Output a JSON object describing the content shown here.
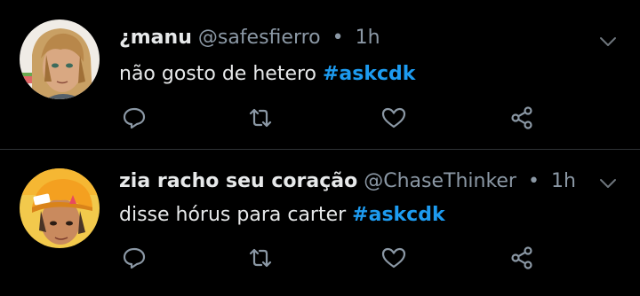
{
  "tweets": [
    {
      "display_name": "¿manu",
      "handle": "@safesfierro",
      "separator": "•",
      "time": "1h",
      "text": "não gosto de hetero",
      "hashtag": "#askcdk",
      "avatar_icon": "avatar-illustrated-blonde-person"
    },
    {
      "display_name": "zia racho seu coração",
      "handle": "@ChaseThinker",
      "separator": "•",
      "time": "1h",
      "text": "disse hórus para carter",
      "hashtag": "#askcdk",
      "avatar_icon": "avatar-illustrated-person-yellow-helmet"
    }
  ],
  "icons": {
    "reply": "reply-icon",
    "retweet": "retweet-icon",
    "like": "like-icon",
    "share": "share-icon",
    "more": "chevron-down-icon"
  },
  "colors": {
    "background": "#000000",
    "text": "#e7e9ea",
    "secondary": "#8b98a5",
    "hashtag": "#1d9bf0",
    "divider": "#2f3336"
  }
}
